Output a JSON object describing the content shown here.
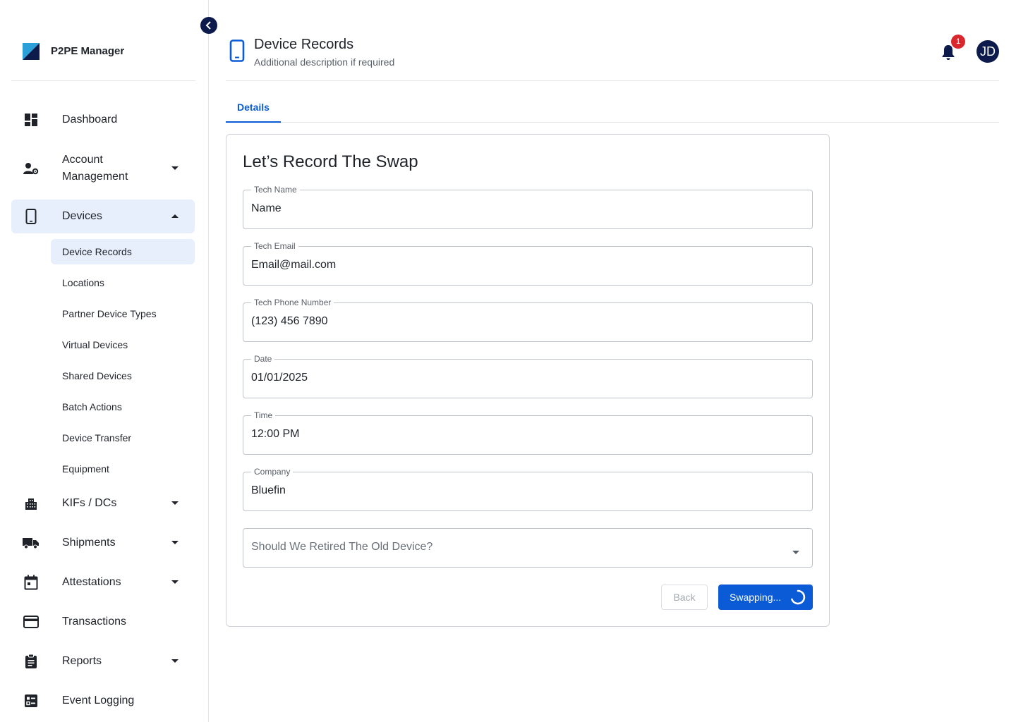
{
  "brand": {
    "name": "P2PE Manager"
  },
  "sidebar": {
    "items": [
      {
        "label": "Dashboard",
        "icon": "dashboard-icon"
      },
      {
        "label": "Account Management",
        "icon": "account-settings-icon"
      },
      {
        "label": "Devices",
        "icon": "phone-icon"
      },
      {
        "label": "KIFs / DCs",
        "icon": "building-icon"
      },
      {
        "label": "Shipments",
        "icon": "truck-icon"
      },
      {
        "label": "Attestations",
        "icon": "calendar-icon"
      },
      {
        "label": "Transactions",
        "icon": "credit-card-icon"
      },
      {
        "label": "Reports",
        "icon": "clipboard-icon"
      },
      {
        "label": "Event Logging",
        "icon": "checklist-icon"
      }
    ],
    "devices_sub": [
      "Device Records",
      "Locations",
      "Partner Device Types",
      "Virtual Devices",
      "Shared Devices",
      "Batch Actions",
      "Device Transfer",
      "Equipment"
    ]
  },
  "header": {
    "title": "Device Records",
    "subtitle": "Additional description if required",
    "notification_count": "1",
    "avatar_initials": "JD"
  },
  "tabs": [
    {
      "label": "Details"
    }
  ],
  "form": {
    "title": "Let’s Record The Swap",
    "fields": [
      {
        "label": "Tech Name",
        "value": "Name"
      },
      {
        "label": "Tech Email",
        "value": "Email@mail.com"
      },
      {
        "label": "Tech Phone Number",
        "value": "(123) 456 7890"
      },
      {
        "label": "Date",
        "value": "01/01/2025"
      },
      {
        "label": "Time",
        "value": "12:00 PM"
      },
      {
        "label": "Company",
        "value": "Bluefin"
      }
    ],
    "retire_select": {
      "placeholder": "Should We Retired The Old Device?"
    },
    "back_label": "Back",
    "submit_label": "Swapping..."
  },
  "colors": {
    "accent": "#0b5ad6",
    "navy": "#0d1b4c",
    "active_bg": "#e8effc",
    "badge": "#d9272e"
  }
}
